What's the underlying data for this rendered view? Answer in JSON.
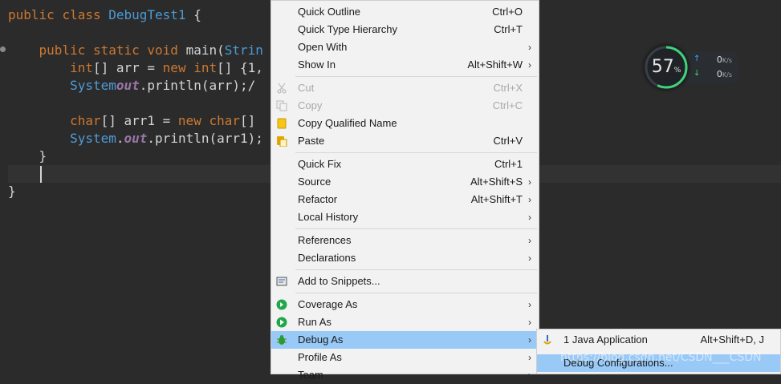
{
  "editor": {
    "lines": [
      {
        "t1": "public ",
        "t2": "class ",
        "t3": "DebugTest1 ",
        "t4": "{"
      },
      {
        "indent": "    ",
        "t1": "public ",
        "t2": "static ",
        "t3": "void ",
        "t4": "main(",
        "t5": "Strin"
      },
      {
        "indent": "        ",
        "t1": "int",
        "t2": "[] arr = ",
        "t3": "new ",
        "t4": "int",
        "t5": "[] {1,"
      },
      {
        "indent": "        ",
        "t1": "System",
        ".": ".",
        "t2": "out",
        ".2": ".",
        "t3": "println(arr);/"
      },
      {
        "indent": "        ",
        "t1": "char",
        "t2": "[] arr1 = ",
        "t3": "new ",
        "t4": "char",
        "t5": "[] "
      },
      {
        "indent": "        ",
        "t1": "System",
        ".": ".",
        "t2": "out",
        ".2": ".",
        "t3": "println(arr1);"
      },
      {
        "indent": "    ",
        "t1": "}"
      },
      {
        "t1": "}"
      }
    ]
  },
  "menu": {
    "items": [
      {
        "label": "Quick Outline",
        "accel": "Ctrl+O"
      },
      {
        "label": "Quick Type Hierarchy",
        "accel": "Ctrl+T"
      },
      {
        "label": "Open With",
        "arrow": "›"
      },
      {
        "label": "Show In",
        "accel": "Alt+Shift+W",
        "arrow": "›"
      },
      {
        "label": "Cut",
        "accel": "Ctrl+X"
      },
      {
        "label": "Copy",
        "accel": "Ctrl+C"
      },
      {
        "label": "Copy Qualified Name"
      },
      {
        "label": "Paste",
        "accel": "Ctrl+V"
      },
      {
        "label": "Quick Fix",
        "accel": "Ctrl+1"
      },
      {
        "label": "Source",
        "accel": "Alt+Shift+S",
        "arrow": "›"
      },
      {
        "label": "Refactor",
        "accel": "Alt+Shift+T",
        "arrow": "›"
      },
      {
        "label": "Local History",
        "arrow": "›"
      },
      {
        "label": "References",
        "arrow": "›"
      },
      {
        "label": "Declarations",
        "arrow": "›"
      },
      {
        "label": "Add to Snippets..."
      },
      {
        "label": "Coverage As",
        "arrow": "›"
      },
      {
        "label": "Run As",
        "arrow": "›"
      },
      {
        "label": "Debug As",
        "arrow": "›"
      },
      {
        "label": "Profile As",
        "arrow": "›"
      },
      {
        "label": "Team",
        "arrow": "›"
      }
    ]
  },
  "submenu": {
    "items": [
      {
        "label": "1 Java Application",
        "accel": "Alt+Shift+D, J"
      },
      {
        "label": "Debug Configurations..."
      }
    ]
  },
  "net": {
    "percent": "57",
    "percent_unit": "%",
    "up": "0",
    "down": "0",
    "unit": "K/s"
  },
  "watermark": "https://blog.csdn.net/CSDN___CSDN",
  "colors": {
    "selection": "#99c9f7",
    "menu_bg": "#f2f2f2",
    "editor_bg": "#2b2b2b"
  }
}
